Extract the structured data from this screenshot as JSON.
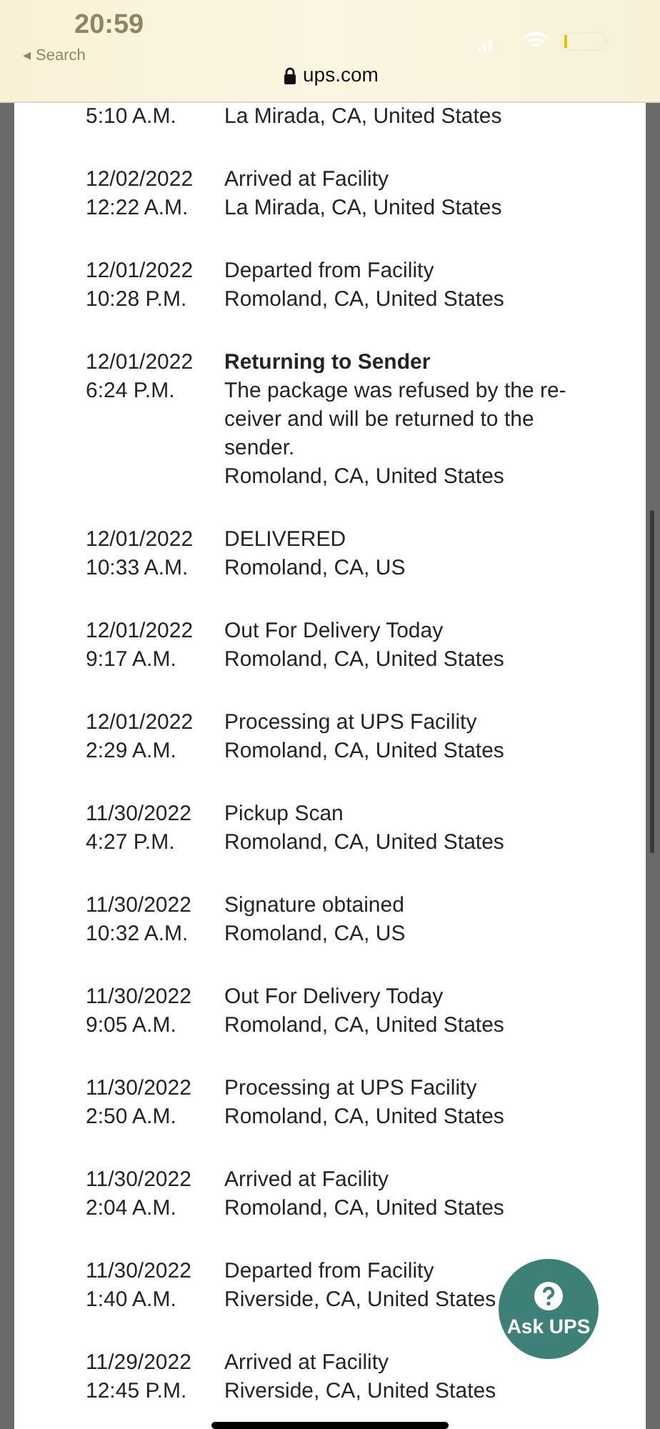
{
  "status_bar": {
    "time": "20:59",
    "back_label": "◂ Search"
  },
  "address_bar": {
    "domain": "ups.com"
  },
  "events": [
    {
      "time": "5:10 A.M.",
      "location": "La Mirada, CA, United States"
    },
    {
      "date": "12/02/2022",
      "time": "12:22 A.M.",
      "status": "Arrived at Facility",
      "bold": false,
      "location": "La Mirada, CA, United States"
    },
    {
      "date": "12/01/2022",
      "time": "10:28 P.M.",
      "status": "Departed from Facility",
      "bold": false,
      "location": "Romoland, CA, United States"
    },
    {
      "date": "12/01/2022",
      "time": "6:24 P.M.",
      "status": "Returning to Sender",
      "bold": true,
      "description": "The package was refused by the re-ceiver and will be returned to the sender.",
      "location": "Romoland, CA, United States"
    },
    {
      "date": "12/01/2022",
      "time": "10:33 A.M.",
      "status": "DELIVERED",
      "bold": false,
      "location": "Romoland, CA, US"
    },
    {
      "date": "12/01/2022",
      "time": "9:17 A.M.",
      "status": "Out For Delivery Today",
      "bold": false,
      "location": "Romoland, CA, United States"
    },
    {
      "date": "12/01/2022",
      "time": "2:29 A.M.",
      "status": "Processing at UPS Facility",
      "bold": false,
      "location": "Romoland, CA, United States"
    },
    {
      "date": "11/30/2022",
      "time": "4:27 P.M.",
      "status": "Pickup Scan",
      "bold": false,
      "location": "Romoland, CA, United States"
    },
    {
      "date": "11/30/2022",
      "time": "10:32 A.M.",
      "status": "Signature obtained",
      "bold": false,
      "location": "Romoland, CA, US"
    },
    {
      "date": "11/30/2022",
      "time": "9:05 A.M.",
      "status": "Out For Delivery Today",
      "bold": false,
      "location": "Romoland, CA, United States"
    },
    {
      "date": "11/30/2022",
      "time": "2:50 A.M.",
      "status": "Processing at UPS Facility",
      "bold": false,
      "location": "Romoland, CA, United States"
    },
    {
      "date": "11/30/2022",
      "time": "2:04 A.M.",
      "status": "Arrived at Facility",
      "bold": false,
      "location": "Romoland, CA, United States"
    },
    {
      "date": "11/30/2022",
      "time": "1:40 A.M.",
      "status": "Departed from Facility",
      "bold": false,
      "location": "Riverside, CA, United States"
    },
    {
      "date": "11/29/2022",
      "time": "12:45 P.M.",
      "status": "Arrived at Facility",
      "bold": false,
      "location": "Riverside, CA, United States"
    }
  ],
  "help_button": {
    "label": "Ask UPS"
  }
}
